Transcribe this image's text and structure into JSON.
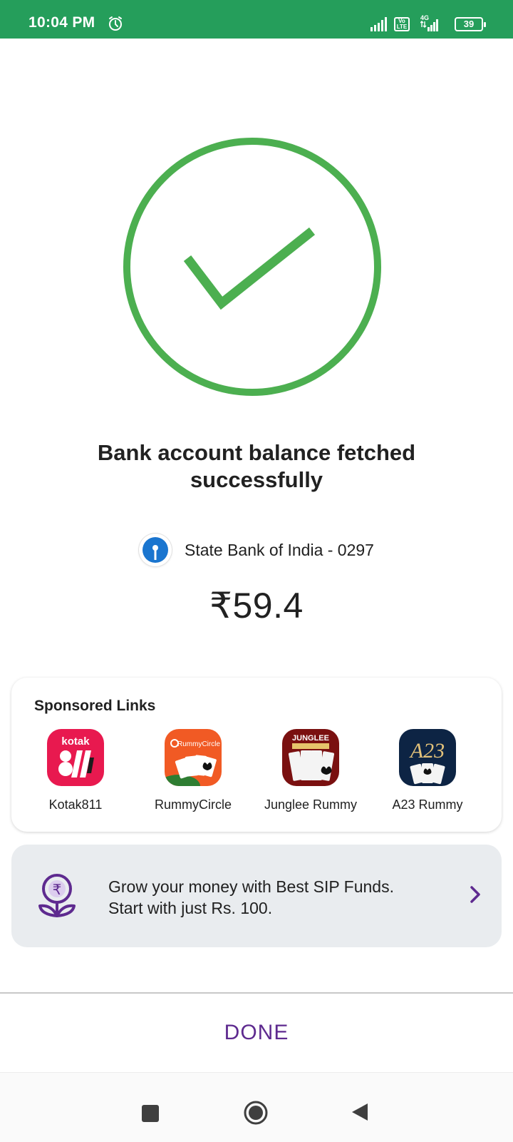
{
  "status_bar": {
    "time": "10:04 PM",
    "network_type": "4G",
    "volte_label": "Vo LTE",
    "battery": "39"
  },
  "result": {
    "title": "Bank account balance fetched successfully",
    "bank_name": "State Bank of India - 0297",
    "balance": "₹59.4",
    "accent_color": "#4caf50"
  },
  "sponsored": {
    "title": "Sponsored Links",
    "apps": [
      {
        "label": "Kotak811",
        "icon": "kotak811-app-icon",
        "icon_text": "kotak",
        "color": "#e8194f"
      },
      {
        "label": "RummyCircle",
        "icon": "rummycircle-app-icon",
        "icon_text": "RummyCircle",
        "color": "#f15a24"
      },
      {
        "label": "Junglee Rummy",
        "icon": "junglee-rummy-app-icon",
        "icon_text": "JUNGLEE",
        "color": "#7a1010"
      },
      {
        "label": "A23 Rummy",
        "icon": "a23-rummy-app-icon",
        "icon_text": "A23",
        "color": "#0d2444"
      }
    ]
  },
  "sip_banner": {
    "line1": "Grow your money with Best SIP Funds.",
    "line2": "Start with just Rs. 100.",
    "accent_color": "#5e2a8f"
  },
  "actions": {
    "done_label": "DONE"
  }
}
